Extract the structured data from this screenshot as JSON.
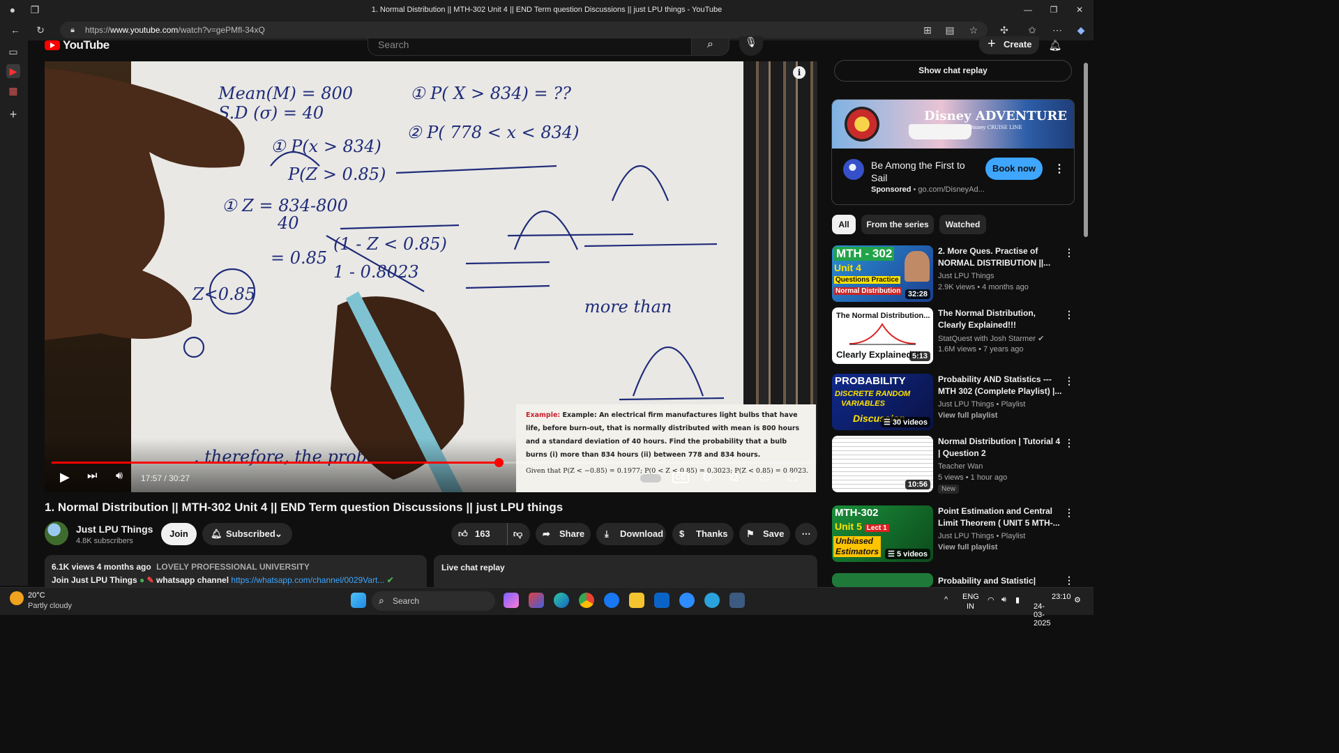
{
  "browser": {
    "window_title": "1. Normal Distribution || MTH-302 Unit 4 || END Term question Discussions || just LPU things - YouTube",
    "url_prefix": "https://",
    "url_host": "www.youtube.com",
    "url_path": "/watch?v=gePMfl-34xQ"
  },
  "masthead": {
    "logo_text": "YouTube",
    "search_placeholder": "Search",
    "create_label": "Create"
  },
  "player": {
    "current_time": "17:57",
    "duration": "30:27",
    "time_display": "17:57 / 30:27",
    "progress_fraction": 0.589,
    "overlay": {
      "text": "Example: An electrical firm manufactures light bulbs that have life, before burn-out, that is normally distributed with mean is 800 hours and a standard deviation of 40 hours. Find the probability that a bulb burns (i) more than 834 hours (ii) between 778 and 834 hours.",
      "given": "Given that P(Z < −0.85) = 0.1977; P(0 < Z < 0.85) = 0.3023; P(Z < 0.85) = 0.8023."
    }
  },
  "video": {
    "title": "1. Normal Distribution || MTH-302 Unit 4 || END Term question Discussions || just LPU things",
    "channel_name": "Just LPU Things",
    "subscribers": "4.8K subscribers",
    "join_label": "Join",
    "subscribed_label": "Subscribed",
    "likes": "163",
    "share_label": "Share",
    "download_label": "Download",
    "thanks_label": "Thanks",
    "save_label": "Save",
    "description": {
      "views_date": "6.1K views  4 months ago",
      "org": "LOVELY PROFESSIONAL UNIVERSITY",
      "line2_prefix": "Join Just LPU Things",
      "line2_mid": "whatsapp channel",
      "line2_link": "https://whatsapp.com/channel/0029Vart..."
    },
    "live_chat_label": "Live chat replay"
  },
  "sidebar": {
    "show_chat_replay": "Show chat replay",
    "ad": {
      "brand": "Disney ADVENTURE",
      "brand_sub": "Disney CRUISE LINE",
      "title": "Be Among the First to Sail",
      "sponsored": "Sponsored",
      "domain": "go.com/DisneyAd...",
      "cta": "Book now"
    },
    "chips": [
      "All",
      "From the series",
      "Watched"
    ],
    "recommendations": [
      {
        "title": "2. More Ques. Practise of NORMAL DISTRIBUTION ||...",
        "channel": "Just LPU Things",
        "meta": "2.9K views  •  4 months ago",
        "duration": "32:28",
        "thumb_text": "MTH - 302 Unit 4 Lecture 2 Questions Practice Normal Distribution"
      },
      {
        "title": "The Normal Distribution, Clearly Explained!!!",
        "channel": "StatQuest with Josh Starmer",
        "meta": "1.6M views  •  7 years ago",
        "duration": "5:13",
        "thumb_text": "The Normal Distribution... Clearly Explained!!!"
      },
      {
        "title": "Probability AND Statistics --- MTH 302 (Complete Playlist)  |...",
        "channel": "Just LPU Things • Playlist",
        "meta": "View full playlist",
        "duration": "30 videos",
        "thumb_text": "PROBABILITY DISCRETE RANDOM VARIABLES Discussion"
      },
      {
        "title": "Normal Distribution | Tutorial 4 | Question 2",
        "channel": "Teacher Wan",
        "meta": "5 views  •  1 hour ago",
        "badge": "New",
        "duration": "10:56"
      },
      {
        "title": "Point Estimation and Central Limit Theorem  ( UNIT 5 MTH-...",
        "channel": "Just LPU Things • Playlist",
        "meta": "View full playlist",
        "duration": "5 videos",
        "thumb_text": "MTH-302 Unit 5 Lect 1 Unbiased Estimators"
      },
      {
        "title": "Probability and Statistic|",
        "channel": "",
        "meta": ""
      }
    ]
  },
  "taskbar": {
    "temperature": "20°C",
    "condition": "Partly cloudy",
    "search_label": "Search",
    "lang1": "ENG",
    "lang2": "IN",
    "time": "23:10",
    "date": "24-03-2025"
  }
}
